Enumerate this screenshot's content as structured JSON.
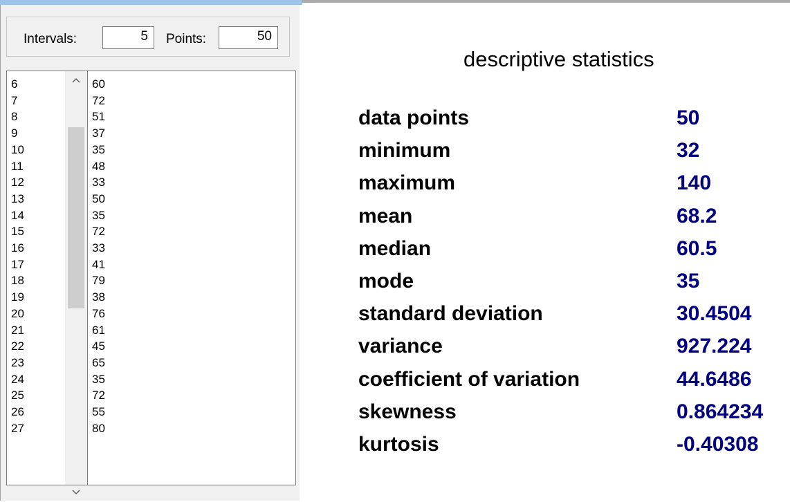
{
  "params": {
    "intervals_label": "Intervals:",
    "intervals_value": "5",
    "points_label": "Points:",
    "points_value": "50"
  },
  "index_list": [
    "6",
    "7",
    "8",
    "9",
    "10",
    "11",
    "12",
    "13",
    "14",
    "15",
    "16",
    "17",
    "18",
    "19",
    "20",
    "21",
    "22",
    "23",
    "24",
    "25",
    "26",
    "27"
  ],
  "value_list": [
    "60",
    "72",
    "51",
    "37",
    "35",
    "48",
    "33",
    "50",
    "35",
    "72",
    "33",
    "41",
    "79",
    "38",
    "76",
    "61",
    "45",
    "65",
    "35",
    "72",
    "55",
    "80"
  ],
  "scroll_icons": {
    "up": "chevron-up-icon",
    "down": "chevron-down-icon"
  },
  "stats": {
    "title": "descriptive statistics",
    "rows": [
      {
        "label": "data points",
        "value": "50"
      },
      {
        "label": "minimum",
        "value": "32"
      },
      {
        "label": "maximum",
        "value": "140"
      },
      {
        "label": "mean",
        "value": "68.2"
      },
      {
        "label": "median",
        "value": "60.5"
      },
      {
        "label": "mode",
        "value": "35"
      },
      {
        "label": "standard deviation",
        "value": "30.4504"
      },
      {
        "label": "variance",
        "value": "927.224"
      },
      {
        "label": "coefficient of variation",
        "value": "44.6486"
      },
      {
        "label": "skewness",
        "value": "0.864234"
      },
      {
        "label": "kurtosis",
        "value": "-0.40308"
      }
    ]
  },
  "colors": {
    "value_text": "#000080",
    "panel_bg": "#f0f0f0"
  }
}
